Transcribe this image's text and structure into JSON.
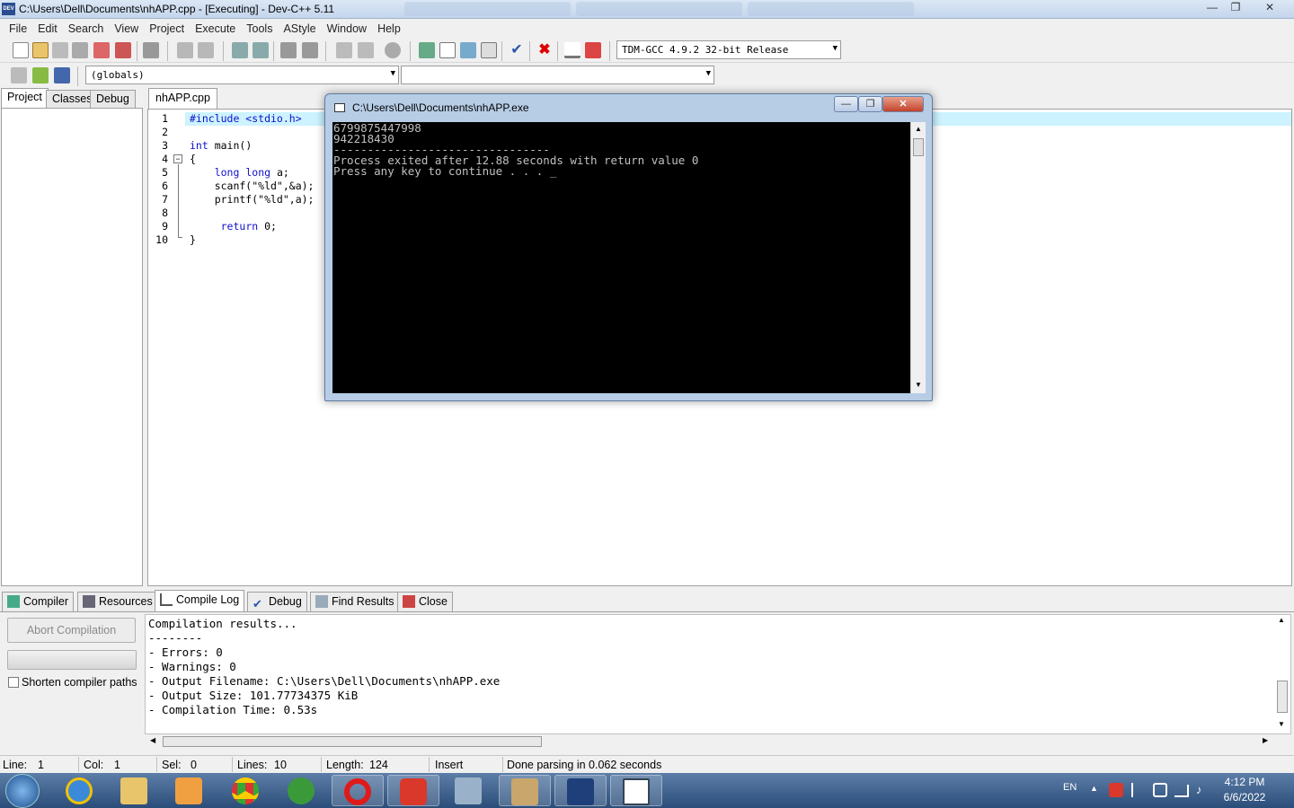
{
  "window": {
    "title": "C:\\Users\\Dell\\Documents\\nhAPP.cpp - [Executing] - Dev-C++ 5.11",
    "icon_label": "DEV",
    "controls": {
      "minimize": "—",
      "restore": "❐",
      "close": "✕"
    }
  },
  "menu": [
    "File",
    "Edit",
    "Search",
    "View",
    "Project",
    "Execute",
    "Tools",
    "AStyle",
    "Window",
    "Help"
  ],
  "toolbar": {
    "compiler_select": "TDM-GCC 4.9.2 32-bit Release",
    "scope_select": "(globals)",
    "member_select": ""
  },
  "left_panel": {
    "tabs": [
      "Project",
      "Classes",
      "Debug"
    ],
    "active_tab": "Project"
  },
  "editor": {
    "file_tab": "nhAPP.cpp",
    "line_numbers": [
      "1",
      "2",
      "3",
      "4",
      "5",
      "6",
      "7",
      "8",
      "9",
      "10"
    ]
  },
  "console": {
    "title": "C:\\Users\\Dell\\Documents\\nhAPP.exe",
    "output": "6799875447998\n942218430\n--------------------------------\nProcess exited after 12.88 seconds with return value 0\nPress any key to continue . . . _"
  },
  "bottom_tabs": [
    "Compiler",
    "Resources",
    "Compile Log",
    "Debug",
    "Find Results",
    "Close"
  ],
  "bottom_active_tab": "Compile Log",
  "compile_panel": {
    "abort_button": "Abort Compilation",
    "shorten_paths_label": "Shorten compiler paths",
    "shorten_paths_checked": false,
    "log": "Compilation results...\n--------\n- Errors: 0\n- Warnings: 0\n- Output Filename: C:\\Users\\Dell\\Documents\\nhAPP.exe\n- Output Size: 101.77734375 KiB\n- Compilation Time: 0.53s"
  },
  "status": {
    "line_label": "Line:",
    "line": "1",
    "col_label": "Col:",
    "col": "1",
    "sel_label": "Sel:",
    "sel": "0",
    "lines_label": "Lines:",
    "lines": "10",
    "length_label": "Length:",
    "length": "124",
    "mode": "Insert",
    "message": "Done parsing in 0.062 seconds"
  },
  "taskbar": {
    "language": "EN",
    "time": "4:12 PM",
    "date": "6/6/2022",
    "apps": [
      "start-orb",
      "internet-explorer",
      "file-explorer",
      "media-player",
      "chrome",
      "coccoc",
      "opera",
      "vivaldi",
      "calculator",
      "free-pascal",
      "dev-cpp",
      "console-window"
    ]
  },
  "colors": {
    "editor_highlight": "#ccf3ff",
    "keyword": "#1010cc",
    "taskbar": "#2b4d79",
    "console_bg": "#000000"
  }
}
